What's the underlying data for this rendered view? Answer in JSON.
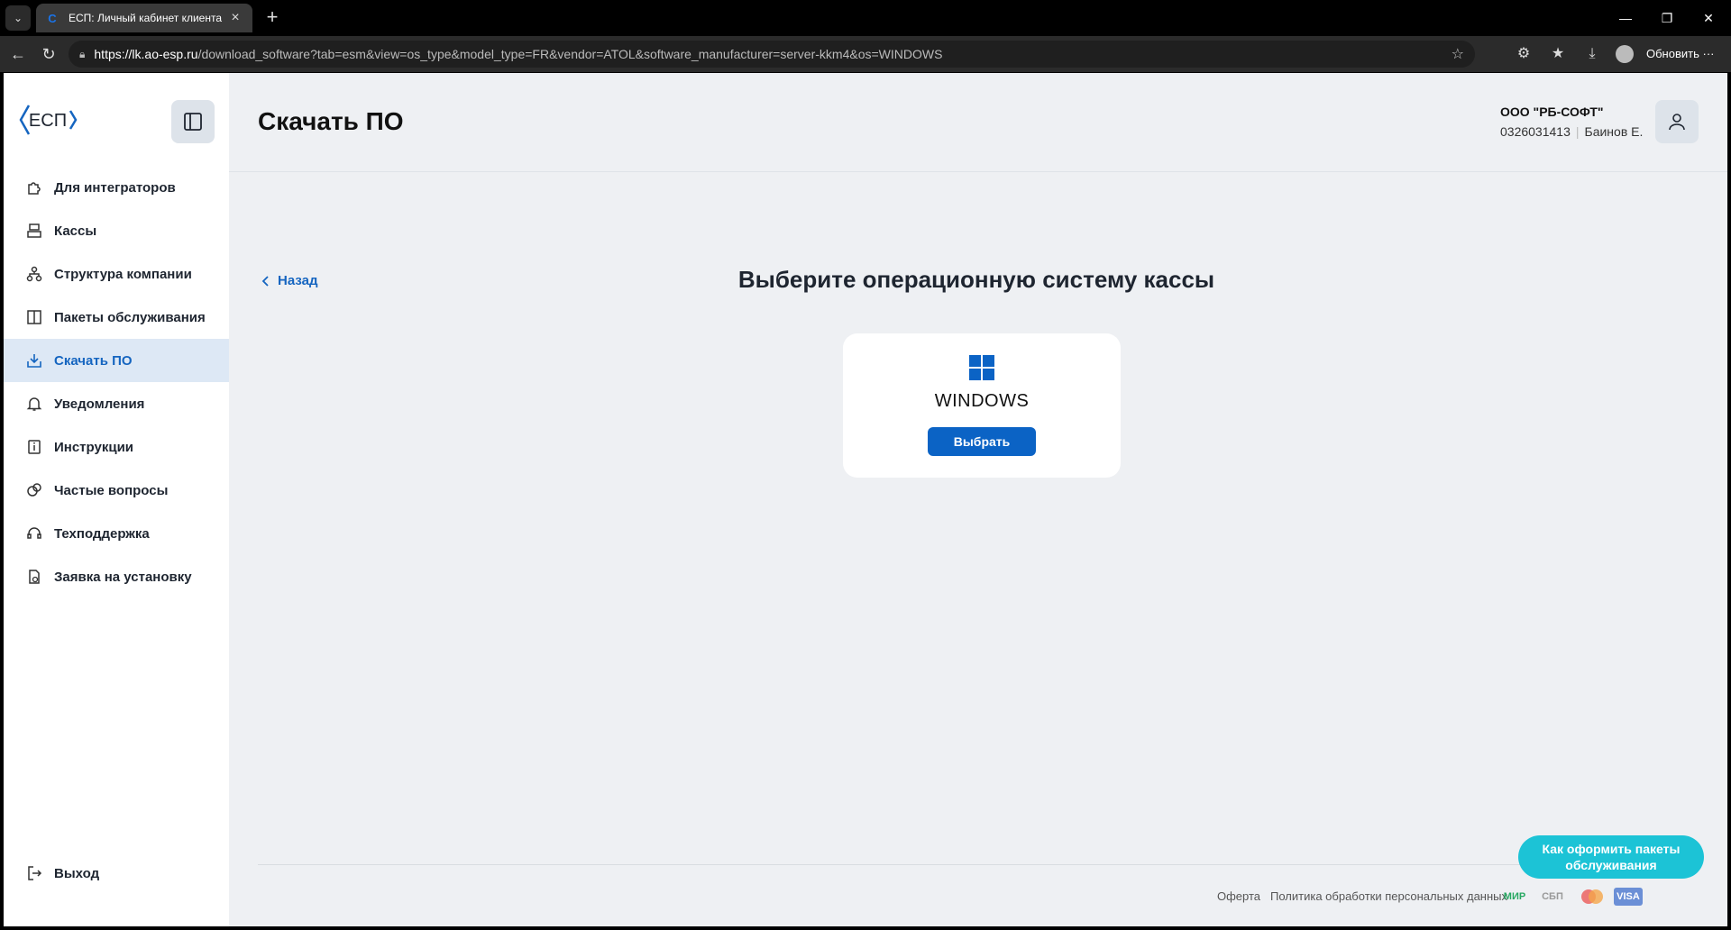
{
  "browser": {
    "tab_title": "ЕСП: Личный кабинет клиента",
    "url_host": "https://lk.ao-esp.ru",
    "url_path": "/download_software?tab=esm&view=os_type&model_type=FR&vendor=ATOL&software_manufacturer=server-kkm4&os=WINDOWS",
    "update_label": "Обновить"
  },
  "logo": {
    "text": "ЕСП"
  },
  "sidebar": {
    "items": [
      {
        "label": "Для интеграторов",
        "icon": "puzzle-icon"
      },
      {
        "label": "Кассы",
        "icon": "cash-register-icon"
      },
      {
        "label": "Структура компании",
        "icon": "hierarchy-icon"
      },
      {
        "label": "Пакеты обслуживания",
        "icon": "package-icon"
      },
      {
        "label": "Скачать ПО",
        "icon": "download-icon",
        "active": true
      },
      {
        "label": "Уведомления",
        "icon": "bell-icon"
      },
      {
        "label": "Инструкции",
        "icon": "info-book-icon"
      },
      {
        "label": "Частые вопросы",
        "icon": "faq-icon"
      },
      {
        "label": "Техподдержка",
        "icon": "headset-icon"
      },
      {
        "label": "Заявка на установку",
        "icon": "request-doc-icon"
      }
    ],
    "logout_label": "Выход"
  },
  "header": {
    "title": "Скачать ПО",
    "company_name": "ООО \"РБ-СОФТ\"",
    "inn": "0326031413",
    "user": "Баинов Е."
  },
  "content": {
    "back_label": "Назад",
    "heading": "Выберите операционную систему кассы",
    "os_card": {
      "name": "WINDOWS",
      "button_label": "Выбрать"
    }
  },
  "footer": {
    "offer_label": "Оферта",
    "privacy_label": "Политика обработки персональных данных",
    "payments": [
      "МИР",
      "СБП",
      "Mastercard",
      "VISA"
    ]
  },
  "help_button": {
    "label": "Как оформить пакеты обслуживания"
  },
  "colors": {
    "accent": "#0b63c5",
    "active_bg": "#dde8f5",
    "help_pill": "#1cc3d6"
  }
}
